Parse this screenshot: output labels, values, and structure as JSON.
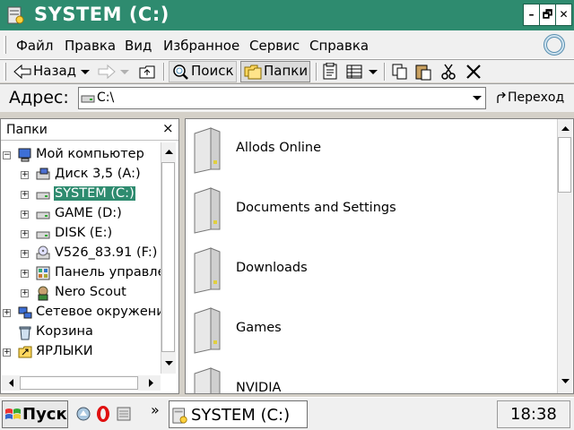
{
  "window": {
    "title": "SYSTEM (C:)"
  },
  "titlebar_buttons": [
    "–",
    "🗗",
    "✕"
  ],
  "menu": [
    "Файл",
    "Правка",
    "Вид",
    "Избранное",
    "Сервис",
    "Справка"
  ],
  "toolbar": {
    "back": "Назад",
    "search": "Поиск",
    "folders": "Папки"
  },
  "address": {
    "label": "Адрес:",
    "value": "C:\\",
    "go": "Переход"
  },
  "tree": {
    "title": "Папки",
    "close": "×",
    "items": [
      {
        "label": "Мой компьютер",
        "expander": "−",
        "icon": "my-computer-icon"
      },
      {
        "label": "Диск 3,5 (A:)",
        "expander": "+",
        "icon": "floppy-drive-icon"
      },
      {
        "label": "SYSTEM (C:)",
        "expander": "+",
        "icon": "hard-drive-icon",
        "selected": true
      },
      {
        "label": "GAME (D:)",
        "expander": "+",
        "icon": "hard-drive-icon"
      },
      {
        "label": "DISK (E:)",
        "expander": "+",
        "icon": "hard-drive-icon"
      },
      {
        "label": "V526_83.91 (F:)",
        "expander": "+",
        "icon": "cd-drive-icon"
      },
      {
        "label": "Панель управле",
        "expander": "+",
        "icon": "control-panel-icon"
      },
      {
        "label": "Nero Scout",
        "expander": "+",
        "icon": "nero-scout-icon"
      },
      {
        "label": "Сетевое окружени",
        "expander": "+",
        "icon": "network-icon"
      },
      {
        "label": "Корзина",
        "expander": "",
        "icon": "recycle-bin-icon"
      },
      {
        "label": "ЯРЛЫКИ",
        "expander": "+",
        "icon": "shortcuts-folder-icon"
      }
    ]
  },
  "files": [
    "Allods Online",
    "Documents and Settings",
    "Downloads",
    "Games",
    "NVIDIA"
  ],
  "taskbar": {
    "start": "Пуск",
    "quicklaunch_more": "»",
    "task": "SYSTEM (C:)",
    "clock": "18:38"
  },
  "colors": {
    "titlebar": "#2e8b6f",
    "selection": "#2e8b6f",
    "chrome": "#f0f0f0"
  }
}
